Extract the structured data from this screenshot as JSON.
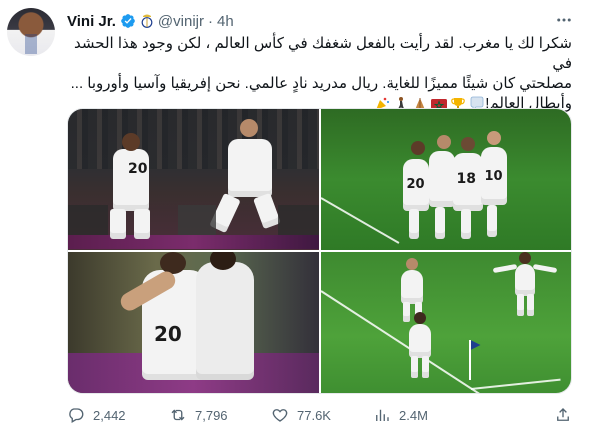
{
  "tweet": {
    "author_name": "Vini Jr.",
    "handle": "@vinijr",
    "separator": "·",
    "time": "4h",
    "text_lines": [
      "شكرا لك يا مغرب. لقد رأيت بالفعل شغفك في كأس العالم ، لكن وجود هذا الحشد في",
      "مصلحتي كان شيئًا مميزًا للغاية. ريال مدريد نادٍ عالمي. نحن إفريقيا وآسيا وأوروبا ...",
      "وأبطال العالم!"
    ],
    "emojis": [
      "speech-bubble",
      "trophy",
      "morocco-flag",
      "prayer-hands",
      "person-walking",
      "celebration"
    ]
  },
  "media": {
    "photos": [
      {
        "name": "photo-celebration-stands",
        "jersey_numbers": [
          "20"
        ]
      },
      {
        "name": "photo-team-huddle",
        "jersey_numbers": [
          "20",
          "18",
          "10"
        ]
      },
      {
        "name": "photo-embrace-closeup",
        "jersey_numbers": [
          "20"
        ]
      },
      {
        "name": "photo-pitch-goal-celebration",
        "jersey_numbers": []
      }
    ]
  },
  "actions": {
    "replies": "2,442",
    "retweets": "7,796",
    "likes": "77.6K",
    "views": "2.4M"
  },
  "colors": {
    "text": "#0f1419",
    "muted": "#536471",
    "verified": "#1d9bf0",
    "border": "#e6e9eb"
  }
}
